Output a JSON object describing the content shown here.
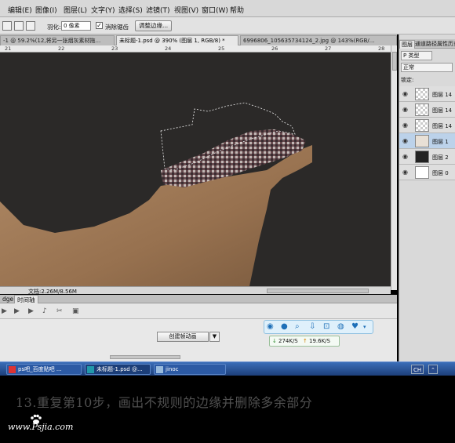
{
  "menu": [
    "编辑(E)",
    "图像(I)",
    "图层(L)",
    "文字(Y)",
    "选择(S)",
    "滤镜(T)",
    "视图(V)",
    "窗口(W)",
    "帮助"
  ],
  "options": {
    "feather_label": "羽化:",
    "feather_value": "0 像素",
    "antialias_label": "消除锯齿",
    "antialias_checked": "✓",
    "refine_edge_button": "调整边缘..."
  },
  "doc_tabs": [
    {
      "label": "-1 @ 59.2%(12,将另一张烟灰素材拖...",
      "close": "×"
    },
    {
      "label": "未标题-1.psd @ 390% (图层 1, RGB/8) *",
      "close": "×"
    },
    {
      "label": "6996806_105635734124_2.jpg @ 143%(RGB/...",
      "close": ""
    }
  ],
  "ruler": [
    "21",
    "22",
    "23",
    "24",
    "25",
    "26",
    "27",
    "28"
  ],
  "status": {
    "doc_info": "文档:2.26M/8.56M"
  },
  "timeline": {
    "tabs": [
      "dge",
      "时间轴"
    ],
    "create_button": "创建帧动画",
    "dropdown_arrow": "▼"
  },
  "floating_toolbar": {
    "icons": [
      "play-icon",
      "user-icon",
      "search-icon",
      "download-icon",
      "lock-icon",
      "bell-icon",
      "location-icon",
      "dropdown-icon"
    ],
    "download_speed": "274K/S",
    "upload_speed": "19.6K/S"
  },
  "panel": {
    "tabs": [
      "图层",
      "通道",
      "路径",
      "属性",
      "历史"
    ],
    "filter_label": "P 类型",
    "blend_mode": "正常",
    "lock_label": "锁定:",
    "layers": [
      {
        "name": "图层 14",
        "thumb": "checker",
        "selected": false
      },
      {
        "name": "图层 14",
        "thumb": "checker",
        "selected": false
      },
      {
        "name": "图层 14",
        "thumb": "checker",
        "selected": false
      },
      {
        "name": "图层 1",
        "thumb": "art",
        "selected": true
      },
      {
        "name": "图层 2",
        "thumb": "dark",
        "selected": false
      },
      {
        "name": "图层 0",
        "thumb": "white",
        "selected": false
      }
    ]
  },
  "taskbar": {
    "tasks": [
      "ps吧_百度贴吧 ...",
      "未标题-1.psd @...",
      "jinoc"
    ],
    "tray": [
      "CH",
      "⌃"
    ]
  },
  "caption": "13.重复第10步，画出不规则的边缘并删除多余部分",
  "watermark": "www.Psjia.com",
  "colors": {
    "canvas_bg": "#2b2928",
    "skin": "#a07a58",
    "taskbar": "#2c5aa4",
    "selected_layer": "#bcd2ea"
  }
}
